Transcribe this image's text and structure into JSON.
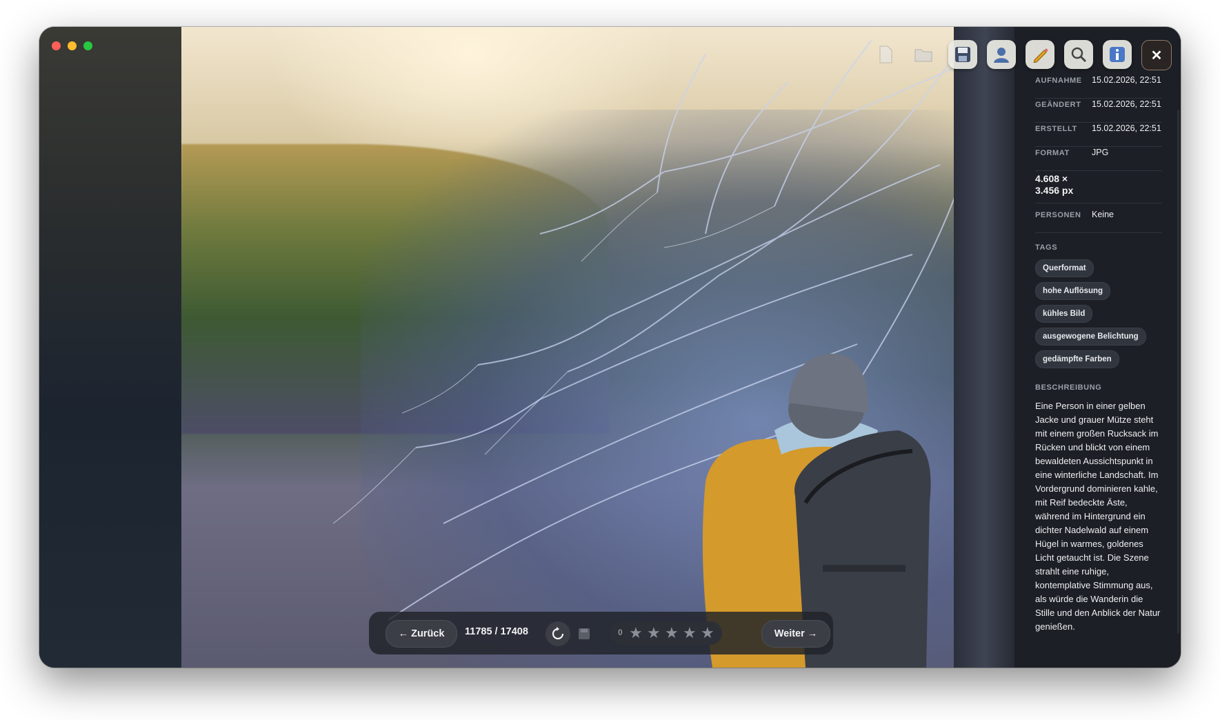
{
  "window": {
    "traffic_lights": [
      "close",
      "minimize",
      "zoom"
    ]
  },
  "toolbar": {
    "icons": [
      "file-icon",
      "folder-icon",
      "save-icon",
      "person-icon",
      "pencil-icon",
      "search-icon",
      "info-icon",
      "close-icon"
    ],
    "close_label": "✕"
  },
  "metadata": {
    "rows": [
      {
        "key": "AUFNAHME",
        "value": "15.02.2026, 22:51"
      },
      {
        "key": "GEÄNDERT",
        "value": "15.02.2026, 22:51"
      },
      {
        "key": "ERSTELLT",
        "value": "15.02.2026, 22:51"
      },
      {
        "key": "FORMAT",
        "value": "JPG"
      }
    ],
    "dimensions_line1": "4.608 ×",
    "dimensions_line2": "3.456 px",
    "persons_key": "PERSONEN",
    "persons_value": "Keine"
  },
  "tags": {
    "title": "TAGS",
    "items": [
      "Querformat",
      "hohe Auflösung",
      "kühles Bild",
      "ausgewogene Belichtung",
      "gedämpfte Farben"
    ]
  },
  "description": {
    "title": "BESCHREIBUNG",
    "text": "Eine Person in einer gelben Jacke und grauer Mütze steht mit einem großen Rucksack im Rücken und blickt von einem bewaldeten Aussichtspunkt in eine winterliche Landschaft. Im Vordergrund dominieren kahle, mit Reif bedeckte Äste, während im Hintergrund ein dichter Nadelwald auf einem Hügel in warmes, goldenes Licht getaucht ist. Die Szene strahlt eine ruhige, kontemplative Stimmung aus, als würde die Wanderin die Stille und den Anblick der Natur genießen."
  },
  "navigation": {
    "back_label": "← Zurück",
    "counter": "11785 / 17408",
    "next_label": "Weiter →",
    "rating_value": "0",
    "rating_max": 5
  },
  "colors": {
    "panel_bg": "#1c1f25",
    "tag_bg": "#30353e",
    "bar_bg": "#202228"
  }
}
